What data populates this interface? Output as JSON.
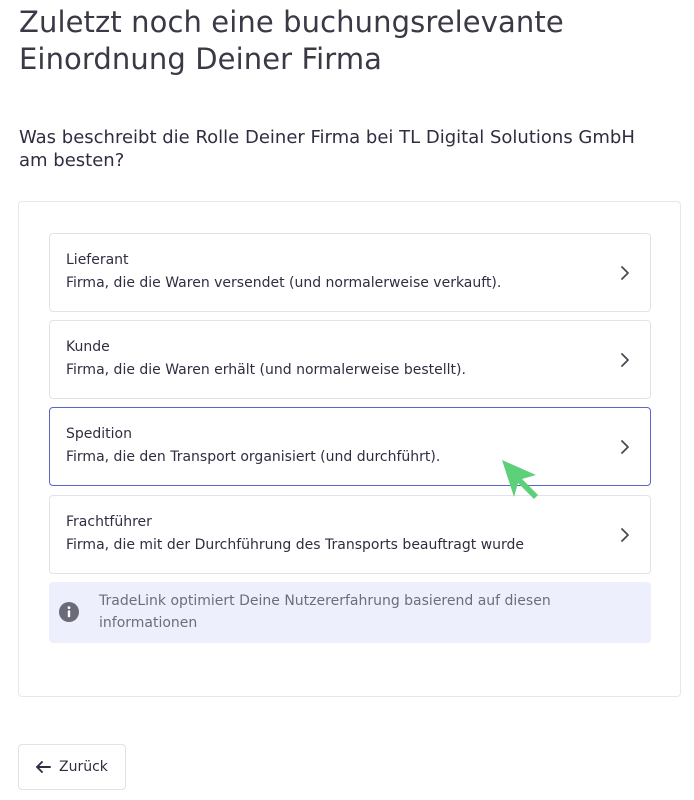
{
  "title": "Zuletzt noch eine buchungsrelevante Einordnung Deiner Firma",
  "question": "Was beschreibt die Rolle Deiner Firma bei TL Digital Solutions GmbH am besten?",
  "options": [
    {
      "title": "Lieferant",
      "description": "Firma, die die Waren versendet (und normalerweise verkauft)."
    },
    {
      "title": "Kunde",
      "description": "Firma, die die Waren erhält (und normalerweise bestellt)."
    },
    {
      "title": "Spedition",
      "description": "Firma, die den Transport organisiert (und durchführt)."
    },
    {
      "title": "Frachtführer",
      "description": "Firma, die mit der Durchführung des Transports beauftragt wurde"
    }
  ],
  "selected_option": "Spedition",
  "info": {
    "text": "TradeLink optimiert Deine Nutzererfahrung basierend auf diesen informationen",
    "icon": "info-icon"
  },
  "back_button": {
    "label": "Zurück",
    "icon": "arrow-left-icon"
  },
  "colors": {
    "selected_border": "#5b66c9",
    "info_background": "#eeeffc",
    "cursor": "#5fd07a"
  }
}
